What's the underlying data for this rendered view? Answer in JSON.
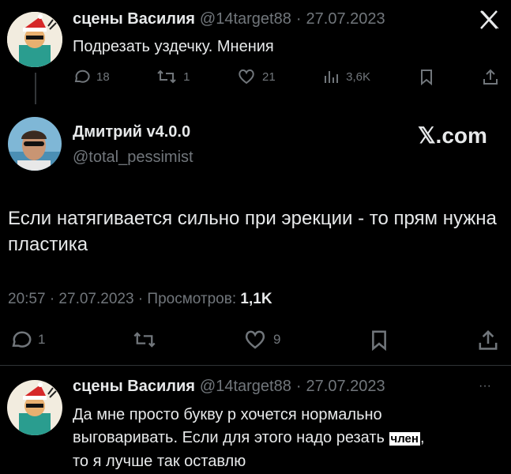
{
  "tweet1": {
    "author": "сцены Василия",
    "handle": "@14target88",
    "date": "27.07.2023",
    "text": "Подрезать уздечку. Мнения",
    "replies": "18",
    "retweets": "1",
    "likes": "21",
    "views": "3,6K",
    "close_icon": "x-logo"
  },
  "tweet2": {
    "author": "Дмитрий v4.0.0",
    "handle": "@total_pessimist",
    "brand": "𝕏.com",
    "text": "Если натягивается сильно при эрекции - то прям нужна пластика",
    "time": "20:57 · 27.07.2023 · Просмотров: ",
    "views": "1,1K",
    "replies": "1",
    "likes": "9"
  },
  "tweet3": {
    "author": "сцены Василия",
    "handle": "@14target88",
    "date": "27.07.2023",
    "text_before": "Да мне просто букву р хочется нормально выговаривать. Если для этого надо резать ",
    "censored": "член",
    "text_after": ",\nто я лучше так оставлю",
    "more": "···"
  }
}
